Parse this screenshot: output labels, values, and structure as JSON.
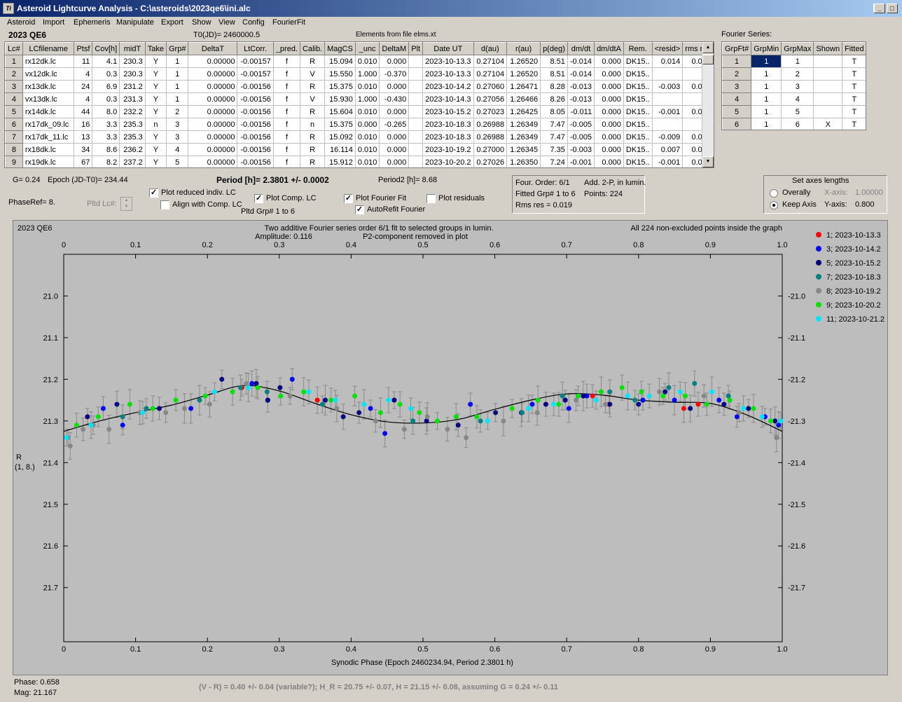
{
  "window": {
    "title": "Asteroid Lightcurve Analysis - C:\\asteroids\\2023qe6\\ini.alc",
    "icon": "app-icon",
    "buttons": [
      "_",
      "□",
      "X"
    ]
  },
  "menu": [
    "Asteroid",
    "Import",
    "Ephemeris",
    "Manipulate",
    "Export",
    "Show",
    "View",
    "Config",
    "FourierFit"
  ],
  "header": {
    "asteroid": "2023 QE6",
    "t0": "T0(JD)= 2460000.5",
    "elements": "Elements from file elms.xt"
  },
  "lc_table": {
    "columns": [
      "Lc#",
      "LCfilename",
      "Ptsf",
      "Cov[h]",
      "midT",
      "Take",
      "Grp#",
      "DeltaT",
      "LtCorr.",
      "_pred.",
      "Calib.",
      "MagCS",
      "_unc",
      "DeltaM",
      "Plt",
      "Date UT",
      "d(au)",
      "r(au)",
      "p(deg)",
      "dm/dt",
      "dm/dtA",
      "Rem.",
      "<resid>",
      "rms res"
    ],
    "rows": [
      [
        "1",
        "rx12dk.lc",
        "11",
        "4.1",
        "230.3",
        "Y",
        "1",
        "0.00000",
        "-0.00157",
        "f",
        "R",
        "15.094",
        "0.010",
        "0.000",
        "",
        "2023-10-13.3",
        "0.27104",
        "1.26520",
        "8.51",
        "-0.014",
        "0.000",
        "DK15..",
        "0.014",
        "0.018"
      ],
      [
        "2",
        "vx12dk.lc",
        "4",
        "0.3",
        "230.3",
        "Y",
        "1",
        "0.00000",
        "-0.00157",
        "f",
        "V",
        "15.550",
        "1.000",
        "-0.370",
        "",
        "2023-10-13.3",
        "0.27104",
        "1.26520",
        "8.51",
        "-0.014",
        "0.000",
        "DK15..",
        "",
        ""
      ],
      [
        "3",
        "rx13dk.lc",
        "24",
        "6.9",
        "231.2",
        "Y",
        "1",
        "0.00000",
        "-0.00156",
        "f",
        "R",
        "15.375",
        "0.010",
        "0.000",
        "",
        "2023-10-14.2",
        "0.27060",
        "1.26471",
        "8.28",
        "-0.013",
        "0.000",
        "DK15..",
        "-0.003",
        "0.012"
      ],
      [
        "4",
        "vx13dk.lc",
        "4",
        "0.3",
        "231.3",
        "Y",
        "1",
        "0.00000",
        "-0.00156",
        "f",
        "V",
        "15.930",
        "1.000",
        "-0.430",
        "",
        "2023-10-14.3",
        "0.27056",
        "1.26466",
        "8.26",
        "-0.013",
        "0.000",
        "DK15..",
        "",
        ""
      ],
      [
        "5",
        "rx14dk.lc",
        "44",
        "8.0",
        "232.2",
        "Y",
        "2",
        "0.00000",
        "-0.00156",
        "f",
        "R",
        "15.604",
        "0.010",
        "0.000",
        "",
        "2023-10-15.2",
        "0.27023",
        "1.26425",
        "8.05",
        "-0.011",
        "0.000",
        "DK15..",
        "-0.001",
        "0.017"
      ],
      [
        "6",
        "rx17dk_09.lc",
        "16",
        "3.3",
        "235.3",
        "n",
        "3",
        "0.00000",
        "-0.00156",
        "f",
        "n",
        "15.375",
        "0.000",
        "-0.265",
        "",
        "2023-10-18.3",
        "0.26988",
        "1.26349",
        "7.47",
        "-0.005",
        "0.000",
        "DK15..",
        "",
        ""
      ],
      [
        "7",
        "rx17dk_11.lc",
        "13",
        "3.3",
        "235.3",
        "Y",
        "3",
        "0.00000",
        "-0.00156",
        "f",
        "R",
        "15.092",
        "0.010",
        "0.000",
        "",
        "2023-10-18.3",
        "0.26988",
        "1.26349",
        "7.47",
        "-0.005",
        "0.000",
        "DK15..",
        "-0.009",
        "0.024"
      ],
      [
        "8",
        "rx18dk.lc",
        "34",
        "8.6",
        "236.2",
        "Y",
        "4",
        "0.00000",
        "-0.00156",
        "f",
        "R",
        "16.114",
        "0.010",
        "0.000",
        "",
        "2023-10-19.2",
        "0.27000",
        "1.26345",
        "7.35",
        "-0.003",
        "0.000",
        "DK15..",
        "0.007",
        "0.021"
      ],
      [
        "9",
        "rx19dk.lc",
        "67",
        "8.2",
        "237.2",
        "Y",
        "5",
        "0.00000",
        "-0.00156",
        "f",
        "R",
        "15.912",
        "0.010",
        "0.000",
        "",
        "2023-10-20.2",
        "0.27026",
        "1.26350",
        "7.24",
        "-0.001",
        "0.000",
        "DK15..",
        "-0.001",
        "0.020"
      ]
    ]
  },
  "fourier_series": {
    "label": "Fourier Series:",
    "columns": [
      "GrpFt#",
      "GrpMin",
      "GrpMax",
      "Shown",
      "Fitted"
    ],
    "rows": [
      [
        "1",
        "1",
        "1",
        "",
        "T"
      ],
      [
        "2",
        "1",
        "2",
        "",
        "T"
      ],
      [
        "3",
        "1",
        "3",
        "",
        "T"
      ],
      [
        "4",
        "1",
        "4",
        "",
        "T"
      ],
      [
        "5",
        "1",
        "5",
        "",
        "T"
      ],
      [
        "6",
        "1",
        "6",
        "X",
        "T"
      ]
    ]
  },
  "controls": {
    "g": "G= 0.24",
    "epoch": "Epoch (JD-T0)= 234.44",
    "period": "Period [h]= 2.3801 +/- 0.0002",
    "period2": "Period2 [h]= 8.68",
    "phaseref": "PhaseRef= 8.",
    "pltd_lc": "Pltd Lc#:",
    "plot_reduced": "Plot reduced indiv. LC",
    "align": "Align with Comp. LC",
    "plot_comp": "Plot Comp. LC",
    "pltd_grp": "Pltd Grp#  1   to   6",
    "plot_fourier": "Plot Fourier Fit",
    "autorefit": "AutoRefit Fourier",
    "plot_residuals": "Plot residuals",
    "four_order": "Four. Order:  6/1",
    "add": "Add. 2-P, in lumin.",
    "fitted": "Fitted Grp# 1 to 6",
    "points": "Points: 224",
    "rms": "Rms res     = 0.019",
    "axes_title": "Set axes lengths",
    "overally": "Overally",
    "keep_axis": "Keep Axis",
    "xaxis": "X-axis:",
    "xaxis_val": "1.00000",
    "yaxis": "Y-axis:",
    "yaxis_val": "0.800"
  },
  "plot_text": {
    "name": "2023 QE6",
    "title1": "Two additive Fourier series order 6/1 fit to selected groups in lumin.",
    "title2": "Amplitude: 0.116",
    "title3": "P2-component removed in plot",
    "right": "All 224 non-excluded points inside the graph",
    "ylabel": "R",
    "ylabel2": "(1, 8.)",
    "xlabel": "Synodic Phase (Epoch 2460234.94, Period 2.3801 h)"
  },
  "status": {
    "phase": "Phase:  0.658",
    "mag": "Mag:    21.167",
    "result": "(V - R) = 0.40 +/- 0.04 (variable?); H_R = 20.75 +/- 0.07, H = 21.15 +/- 0.08, assuming G = 0.24 +/- 0.11"
  },
  "chart_data": {
    "type": "scatter",
    "title": "Two additive Fourier series order 6/1 fit to selected groups in lumin.",
    "xlabel": "Synodic Phase (Epoch 2460234.94, Period 2.3801 h)",
    "ylabel": "R",
    "xlim": [
      0,
      1
    ],
    "ylim": [
      21.83,
      20.9
    ],
    "xticks": [
      0,
      0.1,
      0.2,
      0.3,
      0.4,
      0.5,
      0.6,
      0.7,
      0.8,
      0.9,
      1.0
    ],
    "yticks": [
      21.0,
      21.1,
      21.2,
      21.3,
      21.4,
      21.5,
      21.6,
      21.7
    ],
    "legend_position": "right",
    "series": [
      {
        "name": "1; 2023-10-13.3",
        "color": "#ff0000",
        "x": [
          0.248,
          0.353,
          0.736,
          0.759,
          0.863,
          0.883
        ],
        "y": [
          21.22,
          21.25,
          21.24,
          21.26,
          21.27,
          21.26
        ]
      },
      {
        "name": "3; 2023-10-14.2",
        "color": "#0000ff",
        "x": [
          0.055,
          0.082,
          0.177,
          0.262,
          0.318,
          0.427,
          0.447,
          0.566,
          0.652,
          0.703,
          0.728,
          0.806,
          0.85,
          0.912,
          0.937,
          0.976,
          0.995
        ],
        "y": [
          21.27,
          21.31,
          21.27,
          21.21,
          21.2,
          21.27,
          21.33,
          21.26,
          21.26,
          21.27,
          21.24,
          21.25,
          21.25,
          21.25,
          21.29,
          21.29,
          21.31
        ]
      },
      {
        "name": "5; 2023-10-15.2",
        "color": "#000080",
        "x": [
          0.033,
          0.074,
          0.133,
          0.22,
          0.268,
          0.284,
          0.301,
          0.364,
          0.389,
          0.411,
          0.46,
          0.505,
          0.549,
          0.601,
          0.637,
          0.671,
          0.698,
          0.723,
          0.76,
          0.8,
          0.837,
          0.872,
          0.919,
          0.953,
          0.99
        ],
        "y": [
          21.29,
          21.26,
          21.27,
          21.2,
          21.21,
          21.25,
          21.22,
          21.25,
          21.29,
          21.28,
          21.25,
          21.3,
          21.31,
          21.28,
          21.28,
          21.26,
          21.25,
          21.24,
          21.26,
          21.26,
          21.23,
          21.27,
          21.26,
          21.27,
          21.3
        ]
      },
      {
        "name": "7; 2023-10-18.3",
        "color": "#008080",
        "x": [
          0.082,
          0.115,
          0.189,
          0.246,
          0.283,
          0.36,
          0.486,
          0.58,
          0.638,
          0.694,
          0.76,
          0.795,
          0.842,
          0.878,
          0.925
        ],
        "y": [
          21.29,
          21.27,
          21.25,
          21.22,
          21.23,
          21.26,
          21.3,
          21.3,
          21.28,
          21.24,
          21.23,
          21.25,
          21.22,
          21.21,
          21.24
        ]
      },
      {
        "name": "8; 2023-10-19.2",
        "color": "#888888",
        "x": [
          0.006,
          0.009,
          0.027,
          0.041,
          0.063,
          0.106,
          0.142,
          0.168,
          0.203,
          0.254,
          0.315,
          0.38,
          0.434,
          0.474,
          0.506,
          0.534,
          0.56,
          0.612,
          0.659,
          0.713,
          0.754,
          0.829,
          0.891,
          0.94,
          0.992
        ],
        "y": [
          21.34,
          21.36,
          21.32,
          21.31,
          21.32,
          21.28,
          21.28,
          21.27,
          21.26,
          21.21,
          21.24,
          21.27,
          21.3,
          21.32,
          21.29,
          21.32,
          21.34,
          21.3,
          21.28,
          21.25,
          21.26,
          21.23,
          21.24,
          21.28,
          21.34
        ]
      },
      {
        "name": "9; 2023-10-20.2",
        "color": "#00e000",
        "x": [
          0.018,
          0.048,
          0.092,
          0.124,
          0.156,
          0.197,
          0.235,
          0.27,
          0.302,
          0.334,
          0.372,
          0.405,
          0.441,
          0.468,
          0.495,
          0.52,
          0.546,
          0.575,
          0.624,
          0.66,
          0.689,
          0.716,
          0.748,
          0.777,
          0.804,
          0.834,
          0.865,
          0.895,
          0.927,
          0.96,
          0.984
        ],
        "y": [
          21.31,
          21.29,
          21.26,
          21.27,
          21.25,
          21.24,
          21.23,
          21.22,
          21.24,
          21.23,
          21.25,
          21.24,
          21.28,
          21.26,
          21.28,
          21.3,
          21.29,
          21.29,
          21.27,
          21.25,
          21.26,
          21.24,
          21.23,
          21.22,
          21.23,
          21.24,
          21.24,
          21.26,
          21.25,
          21.27,
          21.3
        ]
      },
      {
        "name": "11; 2023-10-21.2",
        "color": "#00e5ff",
        "x": [
          0.004,
          0.038,
          0.11,
          0.21,
          0.257,
          0.341,
          0.378,
          0.418,
          0.452,
          0.483,
          0.59,
          0.647,
          0.682,
          0.741,
          0.785,
          0.815,
          0.858,
          0.902,
          0.946,
          0.972,
          0.998
        ],
        "y": [
          21.34,
          21.31,
          21.28,
          21.23,
          21.22,
          21.23,
          21.25,
          21.26,
          21.25,
          21.27,
          21.3,
          21.27,
          21.26,
          21.25,
          21.24,
          21.24,
          21.23,
          21.23,
          21.27,
          21.29,
          21.3
        ]
      }
    ],
    "fit_curve": {
      "color": "#000000",
      "x": [
        0,
        0.05,
        0.1,
        0.15,
        0.2,
        0.25,
        0.3,
        0.35,
        0.4,
        0.45,
        0.5,
        0.55,
        0.6,
        0.65,
        0.7,
        0.75,
        0.8,
        0.85,
        0.9,
        0.95,
        1.0
      ],
      "y": [
        21.325,
        21.3,
        21.28,
        21.262,
        21.238,
        21.215,
        21.228,
        21.258,
        21.285,
        21.302,
        21.305,
        21.296,
        21.272,
        21.25,
        21.235,
        21.238,
        21.25,
        21.255,
        21.258,
        21.285,
        21.325
      ]
    }
  }
}
